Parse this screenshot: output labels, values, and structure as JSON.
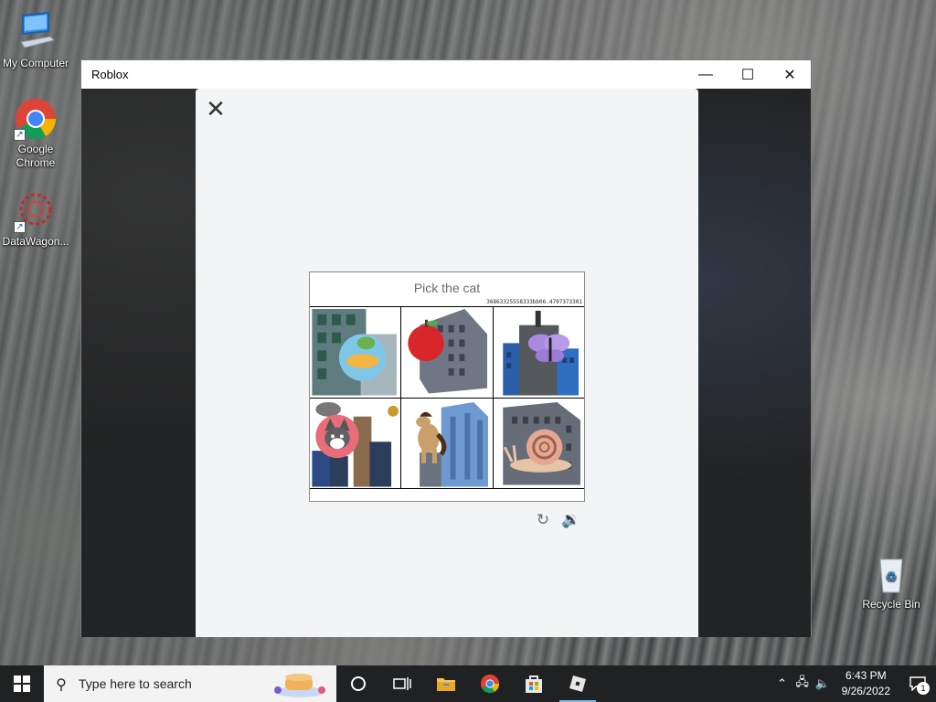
{
  "desktop": {
    "icons": [
      {
        "label": "My Computer"
      },
      {
        "label": "Google Chrome"
      },
      {
        "label": "DataWagon..."
      },
      {
        "label": "Recycle Bin"
      }
    ]
  },
  "window": {
    "title": "Roblox",
    "minimize_glyph": "—",
    "maximize_glyph": "☐",
    "close_glyph": "✕"
  },
  "modal": {
    "close_glyph": "✕"
  },
  "captcha": {
    "prompt": "Pick the cat",
    "id_code": "36863325558333bb06.4797373301",
    "tiles": [
      {
        "icon": "duck-icon",
        "subject": "duck"
      },
      {
        "icon": "apple-icon",
        "subject": "apple"
      },
      {
        "icon": "butterfly-icon",
        "subject": "butterfly"
      },
      {
        "icon": "cat-icon",
        "subject": "cat"
      },
      {
        "icon": "horse-icon",
        "subject": "horse"
      },
      {
        "icon": "snail-icon",
        "subject": "snail"
      }
    ],
    "refresh_glyph": "↻",
    "audio_glyph": "🔉"
  },
  "taskbar": {
    "search_placeholder": "Type here to search",
    "apps": [
      "cortana",
      "task-view",
      "file-explorer",
      "chrome",
      "store",
      "roblox"
    ],
    "clock_time": "6:43 PM",
    "clock_date": "9/26/2022",
    "notification_count": "1"
  },
  "colors": {
    "accent": "#76b9ed",
    "modal_bg": "#f2f4f5",
    "taskbar_bg": "#1f2122"
  }
}
